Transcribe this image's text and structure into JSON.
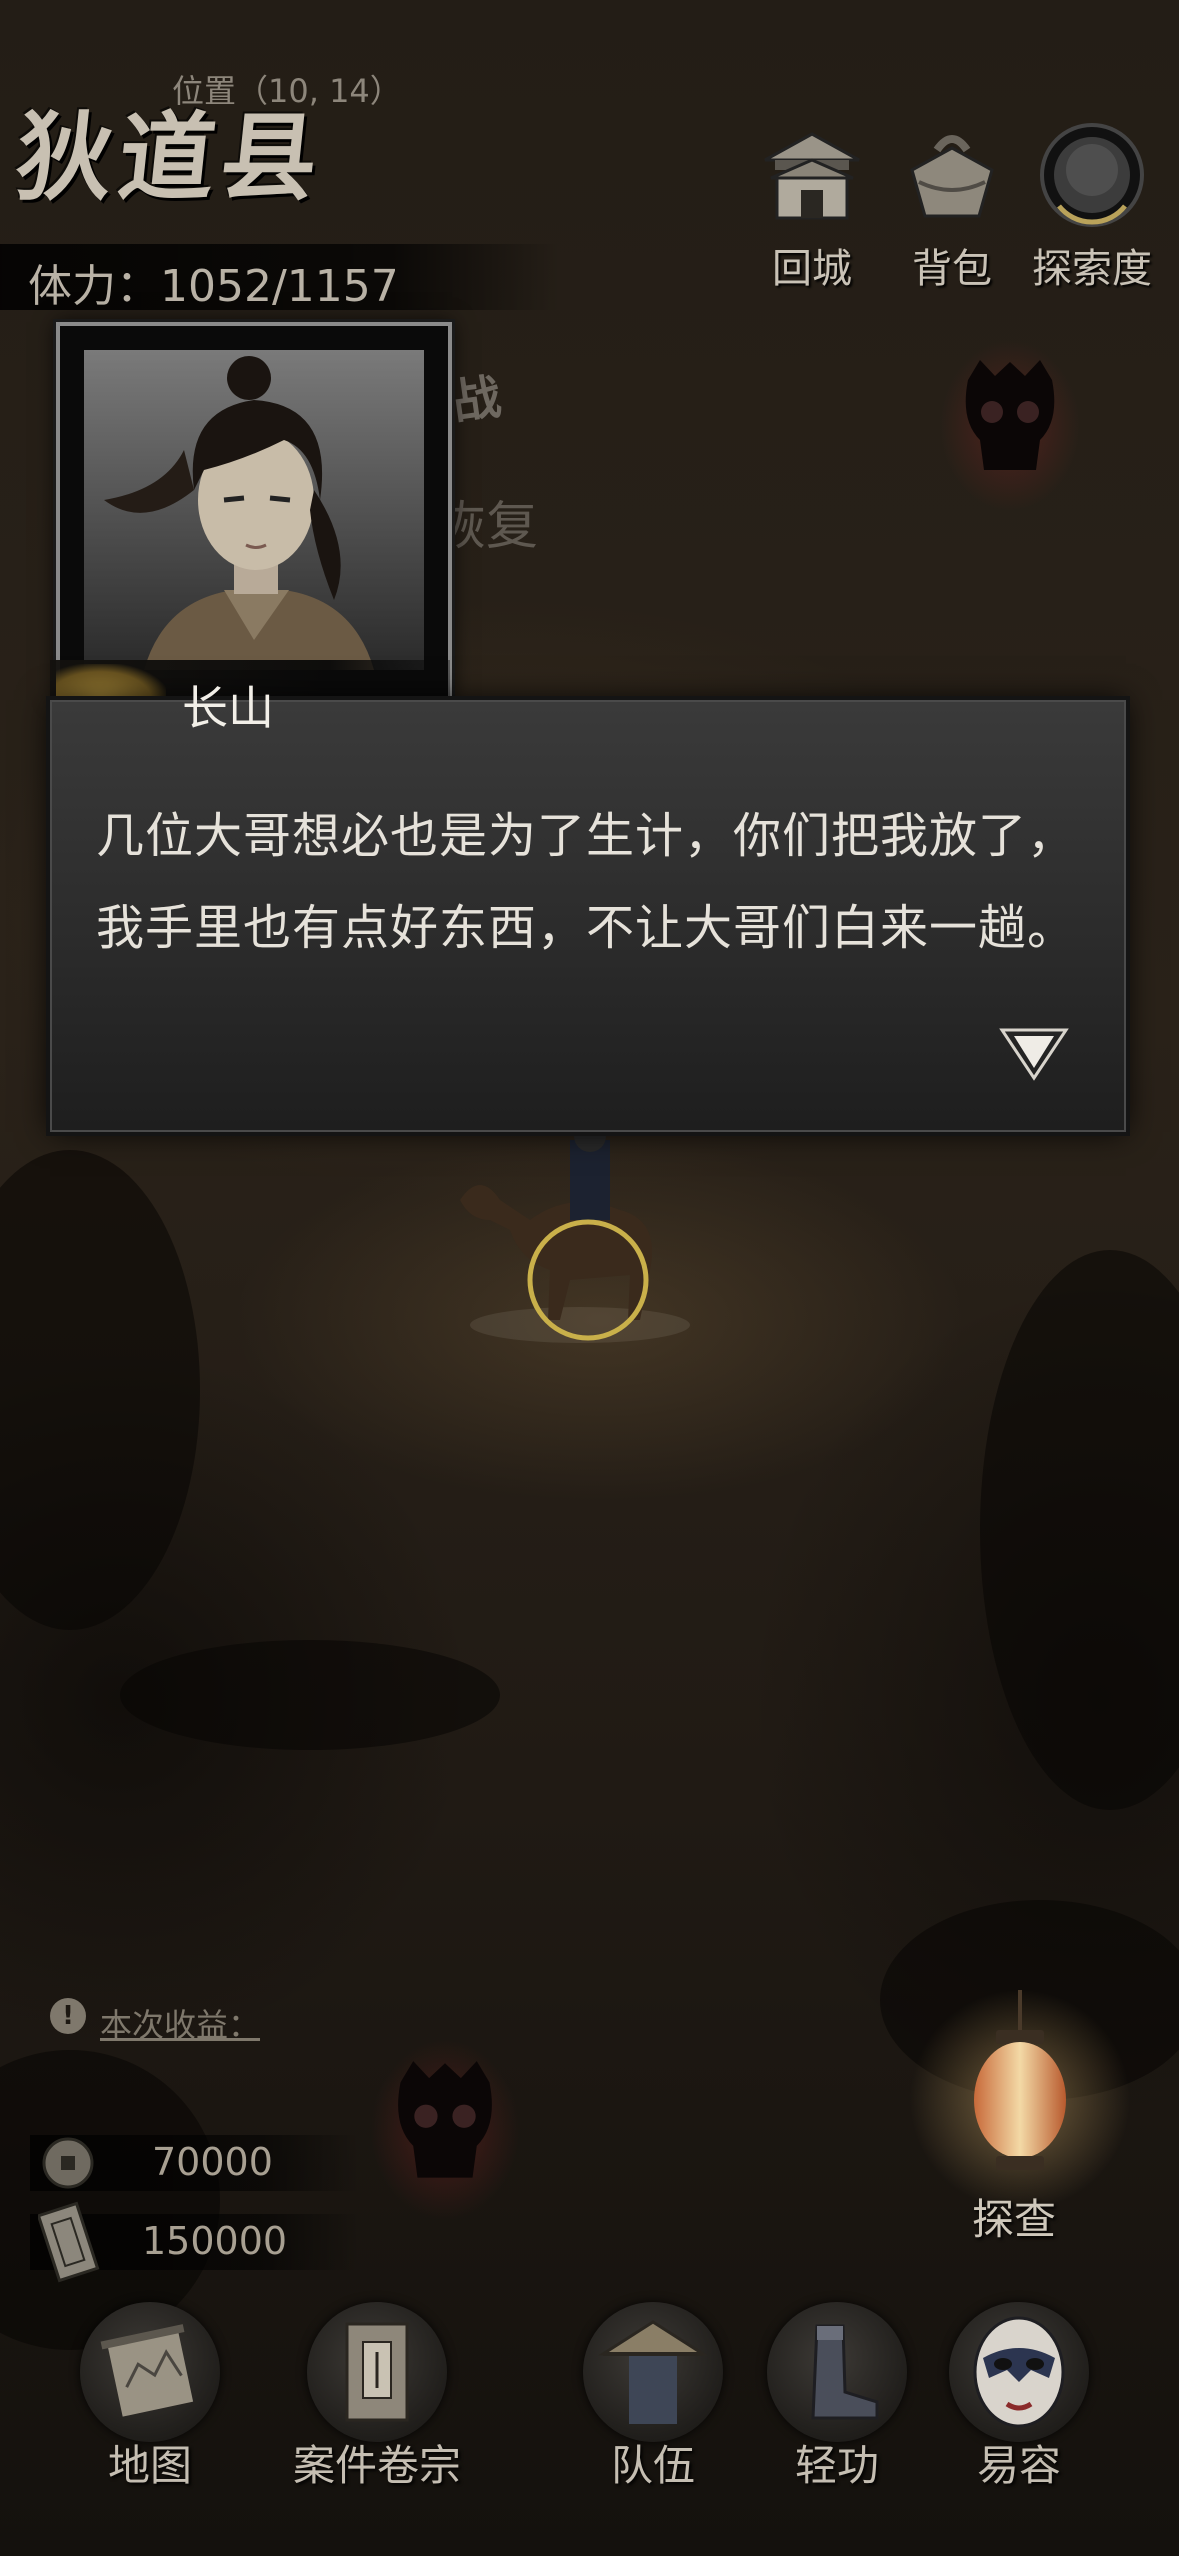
{
  "map": {
    "position_label": "位置（10, 14）",
    "location_name": "狄道县",
    "stamina": "体力：1052/1157"
  },
  "top_buttons": [
    {
      "label": "回城",
      "icon": "city-gate-icon"
    },
    {
      "label": "背包",
      "icon": "bundle-icon"
    },
    {
      "label": "探索度",
      "icon": "exploration-orb-icon"
    }
  ],
  "background_labels": {
    "fight": "战",
    "recover": "恢复"
  },
  "dialog": {
    "speaker": "长山",
    "text": "几位大哥想必也是为了生计，你们把我放了，我手里也有点好东西，不让大哥们白来一趟。"
  },
  "earnings": {
    "label": "本次收益：",
    "coins": "70000",
    "notes": "150000"
  },
  "investigate": {
    "label": "探查"
  },
  "bottom_nav": [
    {
      "label": "地图",
      "icon": "map-scroll-icon"
    },
    {
      "label": "案件卷宗",
      "icon": "case-file-icon"
    },
    {
      "label": "队伍",
      "icon": "team-hat-icon"
    },
    {
      "label": "轻功",
      "icon": "boots-icon"
    },
    {
      "label": "易容",
      "icon": "opera-mask-icon"
    }
  ]
}
